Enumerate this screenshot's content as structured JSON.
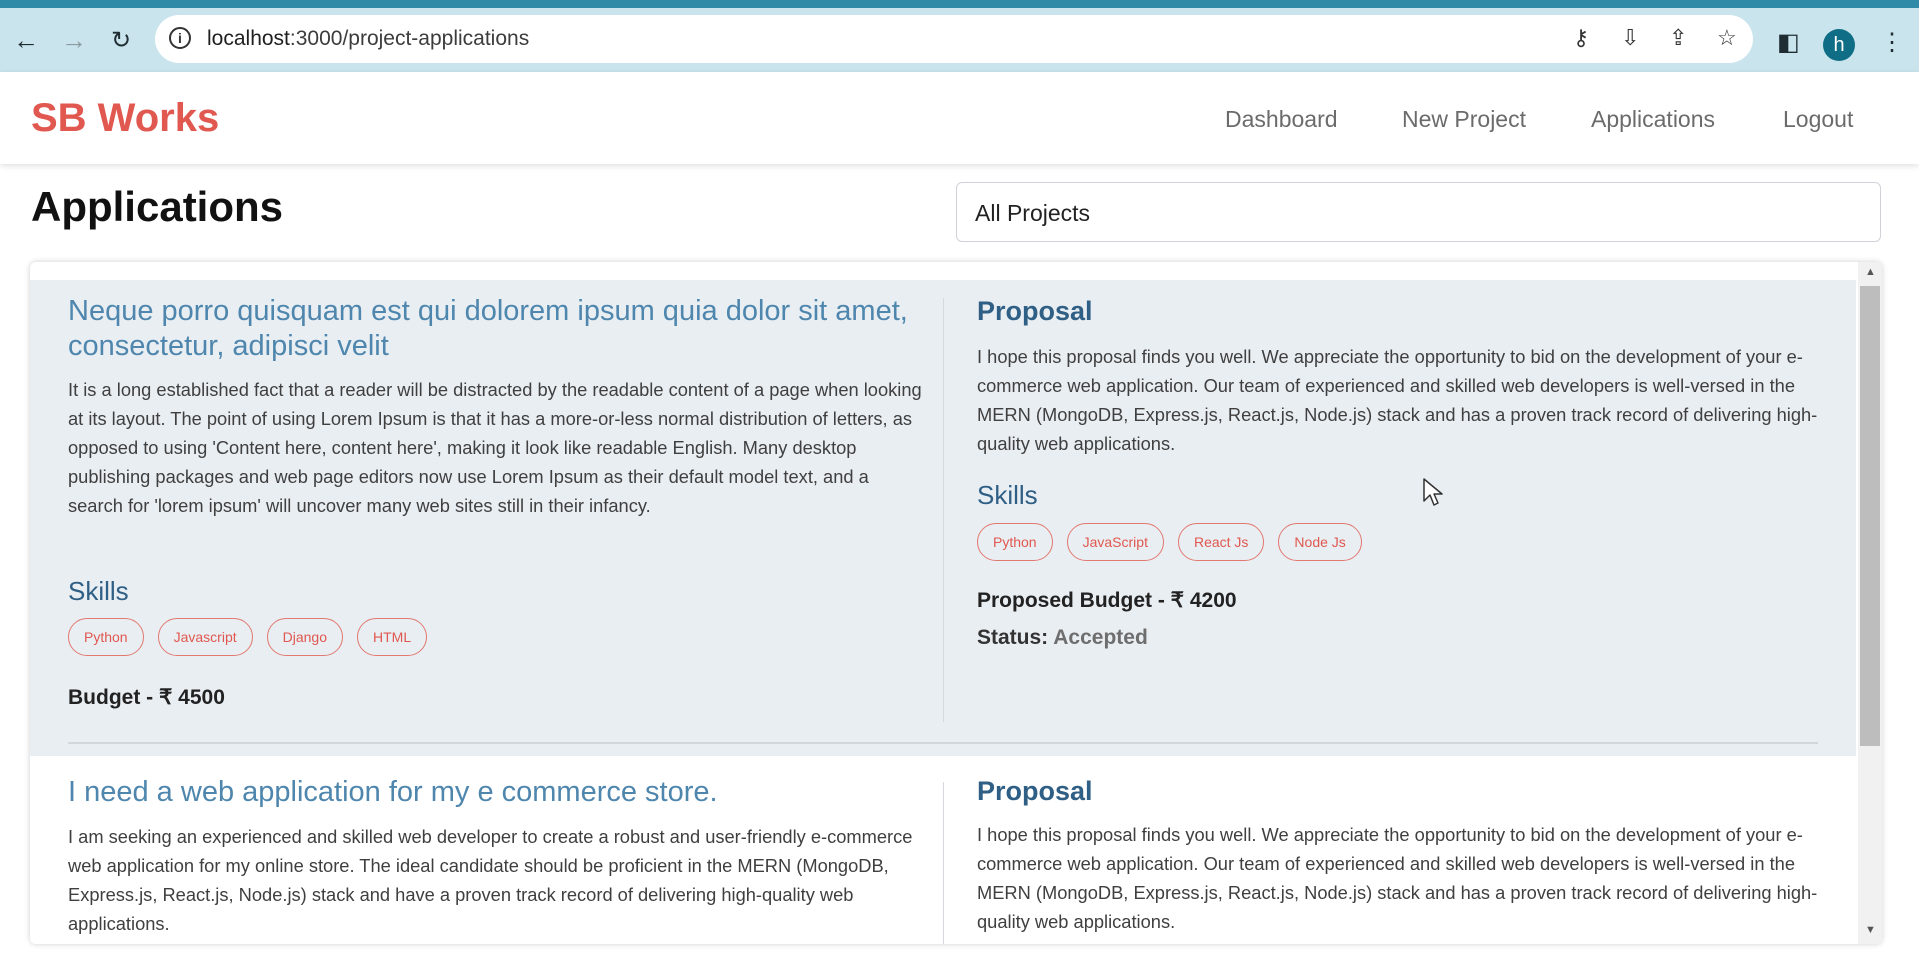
{
  "browser": {
    "url_host": "localhost",
    "url_path": ":3000/project-applications",
    "profile_initial": "h"
  },
  "app": {
    "brand": "SB Works",
    "nav": [
      "Dashboard",
      "New Project",
      "Applications",
      "Logout"
    ]
  },
  "page": {
    "title": "Applications",
    "filter_value": "All Projects"
  },
  "applications": [
    {
      "project_title": "Neque porro quisquam est qui dolorem ipsum quia dolor sit amet, consectetur, adipisci velit",
      "description": "It is a long established fact that a reader will be distracted by the readable content of a page when looking at its layout. The point of using Lorem Ipsum is that it has a more-or-less normal distribution of letters, as opposed to using 'Content here, content here', making it look like readable English. Many desktop publishing packages and web page editors now use Lorem Ipsum as their default model text, and a search for 'lorem ipsum' will uncover many web sites still in their infancy.",
      "skills_heading": "Skills",
      "skills": [
        "Python",
        "Javascript",
        "Django",
        "HTML"
      ],
      "budget": "Budget - ₹ 4500",
      "proposal_heading": "Proposal",
      "proposal": "I hope this proposal finds you well. We appreciate the opportunity to bid on the development of your e-commerce web application. Our team of experienced and skilled web developers is well-versed in the MERN (MongoDB, Express.js, React.js, Node.js) stack and has a proven track record of delivering high-quality web applications.",
      "proposal_skills_heading": "Skills",
      "proposal_skills": [
        "Python",
        "JavaScript",
        "React Js",
        "Node Js"
      ],
      "proposed_budget": "Proposed Budget - ₹ 4200",
      "status_label": "Status:",
      "status_value": "Accepted"
    },
    {
      "project_title": "I need a web application for my e commerce store.",
      "description": "I am seeking an experienced and skilled web developer to create a robust and user-friendly e-commerce web application for my online store. The ideal candidate should be proficient in the MERN (MongoDB, Express.js, React.js, Node.js) stack and have a proven track record of delivering high-quality web applications.",
      "proposal_heading": "Proposal",
      "proposal": "I hope this proposal finds you well. We appreciate the opportunity to bid on the development of your e-commerce web application. Our team of experienced and skilled web developers is well-versed in the MERN (MongoDB, Express.js, React.js, Node.js) stack and has a proven track record of delivering high-quality web applications."
    }
  ]
}
